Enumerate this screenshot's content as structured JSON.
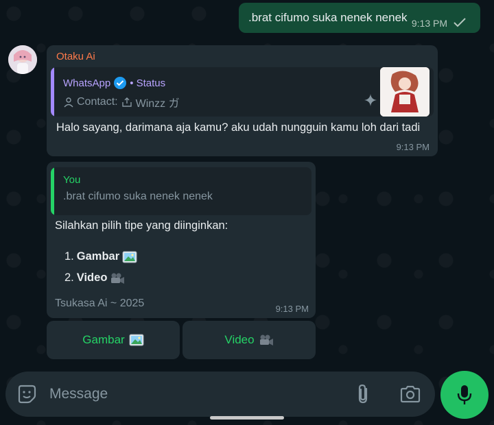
{
  "outgoing": {
    "text": ".brat cifumo suka nenek nenek",
    "time": "9:13 PM",
    "status_icon": "check-icon"
  },
  "incoming1": {
    "sender": "Otaku Ai",
    "quote": {
      "title": "WhatsApp",
      "badge_icon": "verified-icon",
      "status": "• Status",
      "contact": "Contact: ",
      "contact_name": "Winzz ガ"
    },
    "text": "Halo sayang, darimana aja kamu? aku udah nungguin kamu loh dari tadi",
    "time": "9:13 PM"
  },
  "incoming2": {
    "quote_author": "You",
    "quote_text": ".brat cifumo suka nenek nenek",
    "prompt": "Silahkan pilih tipe yang diinginkan:",
    "options": [
      {
        "num": "1.",
        "label": "Gambar",
        "icon": "picture-icon"
      },
      {
        "num": "2.",
        "label": "Video",
        "icon": "movie-camera-icon"
      }
    ],
    "footer": "Tsukasa Ai ~ 2025",
    "time": "9:13 PM"
  },
  "buttons": [
    {
      "label": "Gambar",
      "icon": "picture-icon"
    },
    {
      "label": "Video",
      "icon": "movie-camera-icon"
    }
  ],
  "input": {
    "placeholder": "Message"
  },
  "colors": {
    "accent": "#25d366",
    "sender": "#ff7a4a",
    "outgoing_bg": "#144d37",
    "incoming_bg": "#202c33"
  }
}
